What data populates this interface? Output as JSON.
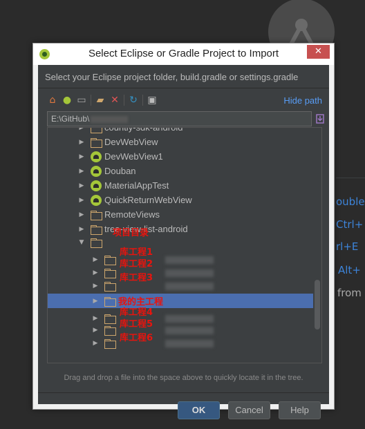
{
  "window": {
    "title": "Select Eclipse or Gradle Project to Import",
    "close_label": "✕"
  },
  "dialog": {
    "subtitle": "Select your Eclipse project folder, build.gradle or settings.gradle",
    "hide_path": "Hide path",
    "path_value": "E:\\GitHub\\",
    "hint": "Drag and drop a file into the space above to quickly locate it in the tree.",
    "buttons": {
      "ok": "OK",
      "cancel": "Cancel",
      "help": "Help"
    }
  },
  "toolbar": [
    {
      "name": "home-icon",
      "glyph": "⌂",
      "color": "#e2783e"
    },
    {
      "name": "android-project-icon",
      "glyph": "●",
      "color": "#a4c639"
    },
    {
      "name": "module-icon",
      "glyph": "▭",
      "color": "#a9a9a9"
    },
    {
      "name": "new-folder-icon",
      "glyph": "▰",
      "color": "#cfa76d"
    },
    {
      "name": "delete-icon",
      "glyph": "✕",
      "color": "#e25555"
    },
    {
      "name": "refresh-icon",
      "glyph": "↻",
      "color": "#3592c4"
    },
    {
      "name": "show-hidden-icon",
      "glyph": "▣",
      "color": "#bbbbbb"
    }
  ],
  "tree": {
    "rows": [
      {
        "label": "countly-sdk-android",
        "icon": "folder",
        "expanded": false
      },
      {
        "label": "DevWebView",
        "icon": "folder",
        "expanded": false
      },
      {
        "label": "DevWebView1",
        "icon": "android",
        "expanded": false
      },
      {
        "label": "Douban",
        "icon": "android",
        "expanded": false
      },
      {
        "label": "MaterialAppTest",
        "icon": "android",
        "expanded": false
      },
      {
        "label": "QuickReturnWebView",
        "icon": "android",
        "expanded": false
      },
      {
        "label": "RemoteViews",
        "icon": "folder",
        "expanded": false
      },
      {
        "label": "tree-view-list-android",
        "icon": "folder",
        "expanded": false
      },
      {
        "label": "项目目录",
        "icon": "folder",
        "expanded": true,
        "annotation": true
      },
      {
        "label": "库工程1",
        "icon": "folder",
        "expanded": false,
        "annotation": true
      },
      {
        "label": "库工程2",
        "icon": "folder",
        "expanded": false,
        "annotation": true
      },
      {
        "label": "库工程3",
        "icon": "folder",
        "expanded": false,
        "annotation": true
      },
      {
        "label": "我的主工程",
        "icon": "folder",
        "expanded": false,
        "annotation": true,
        "selected": true
      },
      {
        "label": "库工程4",
        "icon": "folder",
        "expanded": false,
        "annotation": true
      },
      {
        "label": "库工程5",
        "icon": "folder",
        "expanded": false,
        "annotation": true
      },
      {
        "label": "库工程6",
        "icon": "folder",
        "expanded": false,
        "annotation": true
      }
    ]
  },
  "background": {
    "hints": [
      {
        "text": "ouble",
        "color": "blue"
      },
      {
        "text": "Ctrl+",
        "color": "blue"
      },
      {
        "text": "rl+E",
        "color": "blue"
      },
      {
        "text": "Alt+",
        "color": "blue"
      },
      {
        "text": "from",
        "color": "gray"
      }
    ]
  },
  "colors": {
    "annotation": "#e8140e",
    "selection": "#4b6eaf",
    "link": "#589df6"
  }
}
